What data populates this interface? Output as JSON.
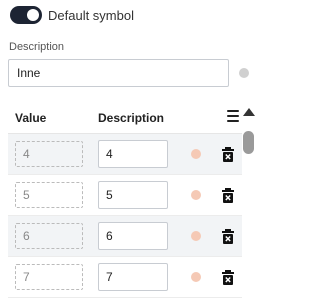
{
  "toggle": {
    "label": "Default symbol",
    "checked": true
  },
  "description": {
    "label": "Description",
    "value": "Inne",
    "color": "#d0d0d0"
  },
  "table": {
    "headers": {
      "value": "Value",
      "description": "Description"
    },
    "rows": [
      {
        "value": "4",
        "description": "4",
        "color": "#f5c9b5"
      },
      {
        "value": "5",
        "description": "5",
        "color": "#f5c9b5"
      },
      {
        "value": "6",
        "description": "6",
        "color": "#f5c9b5"
      },
      {
        "value": "7",
        "description": "7",
        "color": "#f5c9b5"
      }
    ]
  },
  "colors": {
    "toggle_on": "#1d2433",
    "row_alt": "#f2f4f6"
  }
}
